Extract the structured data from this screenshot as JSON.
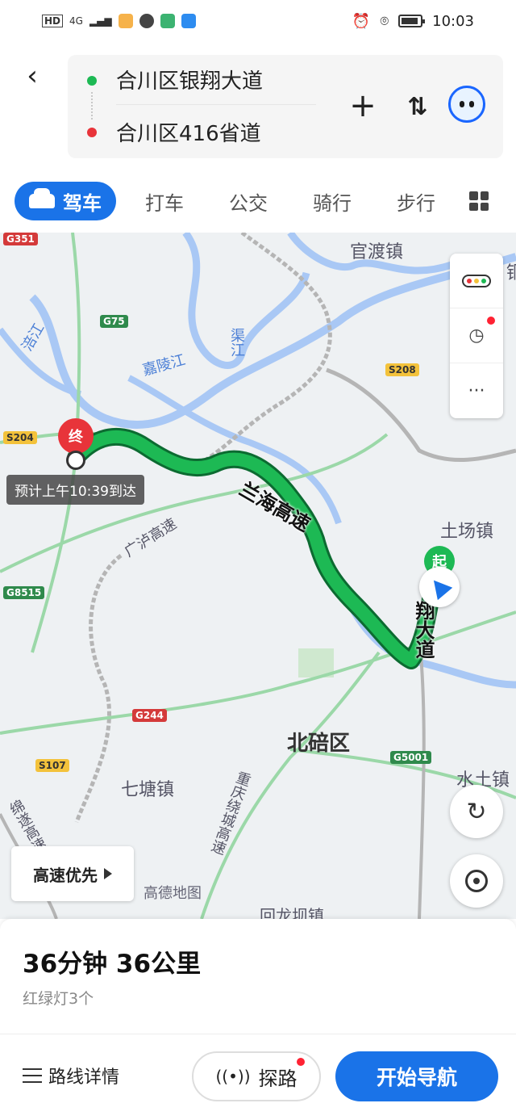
{
  "status_bar": {
    "time": "10:03",
    "network": "4G"
  },
  "route": {
    "start": "合川区银翔大道",
    "end": "合川区416省道"
  },
  "tabs": [
    "驾车",
    "打车",
    "公交",
    "骑行",
    "步行"
  ],
  "map": {
    "labels": {
      "guandu": "官渡镇",
      "jialing": "嘉陵江",
      "qujiang": "渠江",
      "fujiang": "涪江",
      "tuchang": "土场镇",
      "beibei": "北碚区",
      "qitang": "七塘镇",
      "shuitu": "水土镇",
      "guanglu": "广泸高速",
      "chongqing_ring": "重庆绕城高速",
      "partial_right": "铜",
      "bottom_partial": "回龙坝镇",
      "left_partial": "绵遂高速"
    },
    "shields": {
      "g351": "G351",
      "g75": "G75",
      "s204": "S204",
      "s208": "S208",
      "g8515": "G8515",
      "g244": "G244",
      "s107": "S107",
      "g5001": "G5001"
    },
    "route_labels": {
      "highway": "兰海高速",
      "road": "翔大道"
    },
    "end_marker": "终",
    "start_marker": "起",
    "eta": "预计上午10:39到达",
    "highway_pref": "高速优先",
    "watermark": "高德地图"
  },
  "summary": {
    "duration_distance": "36分钟  36公里",
    "traffic_lights": "红绿灯3个"
  },
  "actions": {
    "route_detail": "路线详情",
    "explore": "探路",
    "start_nav": "开始导航"
  },
  "colors": {
    "accent": "#1a73e8",
    "route": "#1db954",
    "end": "#e8343a"
  }
}
